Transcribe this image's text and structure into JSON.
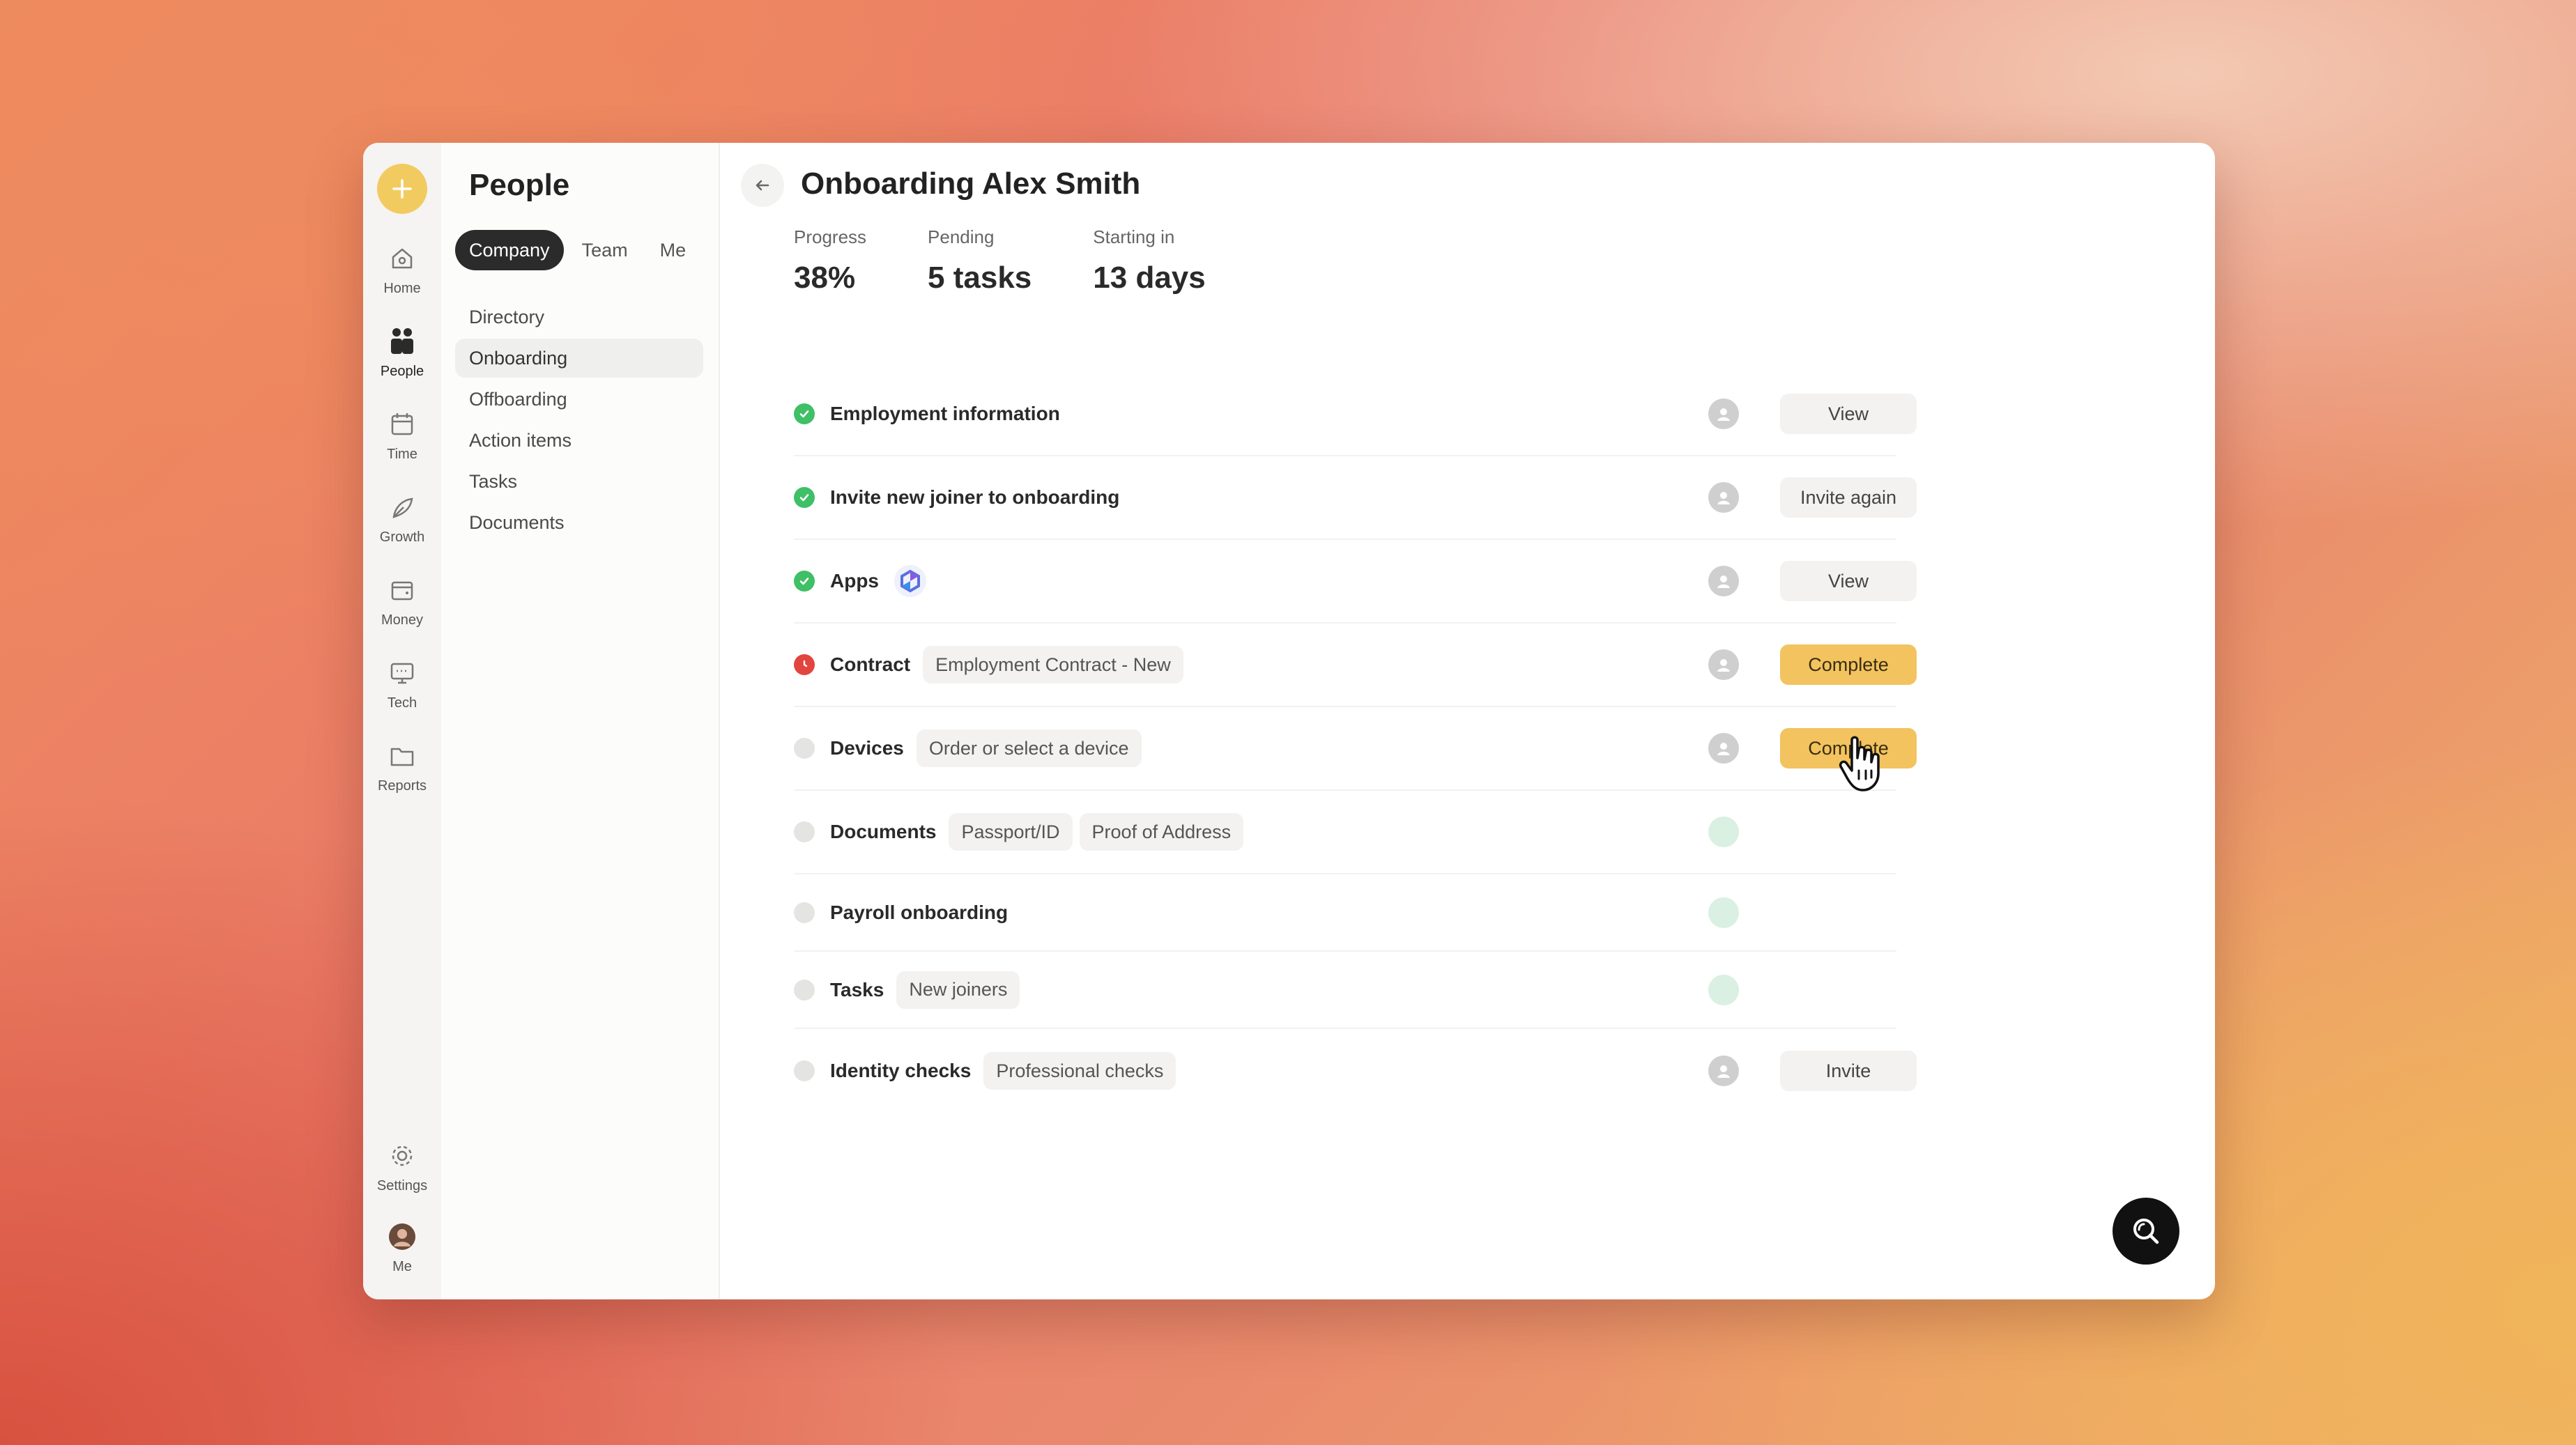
{
  "rail": {
    "items": [
      {
        "label": "Home",
        "icon": "home-icon"
      },
      {
        "label": "People",
        "icon": "people-icon"
      },
      {
        "label": "Time",
        "icon": "calendar-icon"
      },
      {
        "label": "Growth",
        "icon": "leaf-icon"
      },
      {
        "label": "Money",
        "icon": "wallet-icon"
      },
      {
        "label": "Tech",
        "icon": "monitor-icon"
      },
      {
        "label": "Reports",
        "icon": "folder-icon"
      }
    ],
    "settings_label": "Settings",
    "me_label": "Me"
  },
  "subnav": {
    "title": "People",
    "segments": [
      "Company",
      "Team",
      "Me"
    ],
    "selected_segment": "Company",
    "items": [
      "Directory",
      "Onboarding",
      "Offboarding",
      "Action items",
      "Tasks",
      "Documents"
    ],
    "selected_item": "Onboarding"
  },
  "main": {
    "title": "Onboarding Alex Smith",
    "stats": [
      {
        "label": "Progress",
        "value": "38%"
      },
      {
        "label": "Pending",
        "value": "5 tasks"
      },
      {
        "label": "Starting in",
        "value": "13 days"
      }
    ],
    "tasks": [
      {
        "label": "Employment information",
        "status": "done",
        "tags": [],
        "action": "View"
      },
      {
        "label": "Invite new joiner to onboarding",
        "status": "done",
        "tags": [],
        "action": "Invite again"
      },
      {
        "label": "Apps",
        "status": "done",
        "tags": [],
        "action": "View"
      },
      {
        "label": "Contract",
        "status": "overdue",
        "tags": [
          "Employment Contract - New"
        ],
        "action": "Complete"
      },
      {
        "label": "Devices",
        "status": "pending",
        "tags": [
          "Order or select a device"
        ],
        "action": "Complete"
      },
      {
        "label": "Documents",
        "status": "pending",
        "tags": [
          "Passport/ID",
          "Proof of Address"
        ],
        "action": ""
      },
      {
        "label": "Payroll onboarding",
        "status": "pending",
        "tags": [],
        "action": ""
      },
      {
        "label": "Tasks",
        "status": "pending",
        "tags": [
          "New joiners"
        ],
        "action": ""
      },
      {
        "label": "Identity checks",
        "status": "pending",
        "tags": [
          "Professional checks"
        ],
        "action": "Invite"
      }
    ]
  },
  "colors": {
    "accent": "#f2c35f",
    "done": "#3fbf66",
    "overdue": "#e2453e"
  }
}
